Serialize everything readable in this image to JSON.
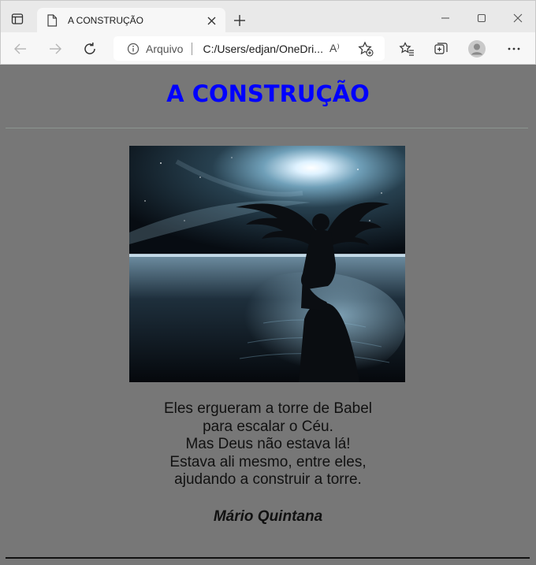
{
  "browser": {
    "tab": {
      "title": "A CONSTRUÇÃO"
    },
    "address": {
      "label": "Arquivo",
      "url": "C:/Users/edjan/OneDri..."
    },
    "read_aloud": "A⁾"
  },
  "page": {
    "title": "A CONSTRUÇÃO",
    "title_color": "#0000ff",
    "background_color": "#777777",
    "image": {
      "description_icon": "angel-silhouette-image"
    },
    "poem_lines": [
      "Eles ergueram a torre de Babel",
      "para escalar o Céu.",
      "Mas Deus não estava lá!",
      "Estava ali mesmo, entre eles,",
      "ajudando a construir a torre."
    ],
    "author": "Mário Quintana"
  }
}
